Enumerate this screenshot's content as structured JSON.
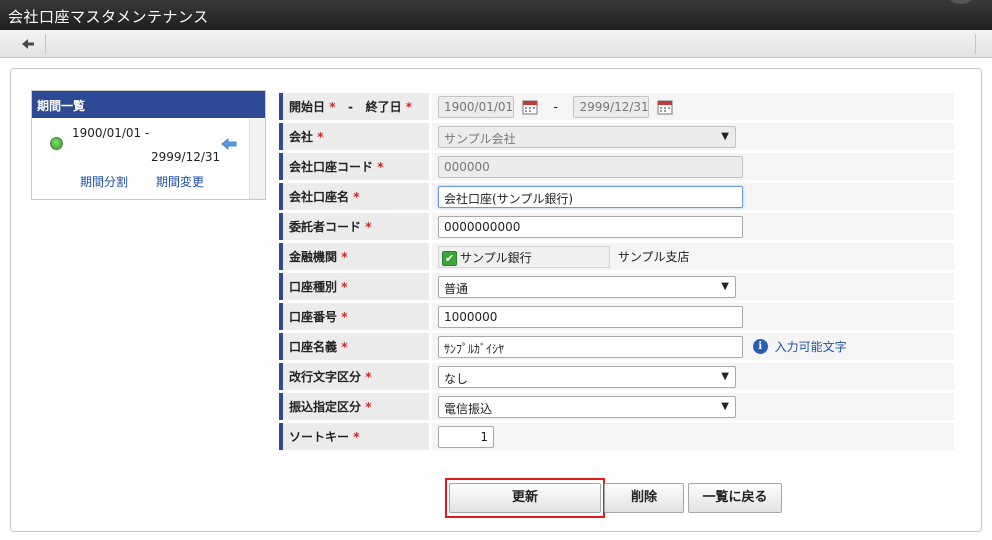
{
  "window": {
    "title": "会社口座マスタメンテナンス"
  },
  "toolbar": {
    "back_icon": "back-arrow-icon"
  },
  "period_list": {
    "header": "期間一覧",
    "items": [
      {
        "start": "1900/01/01  -",
        "end": "2999/12/31"
      }
    ],
    "split_link": "期間分割",
    "change_link": "期間変更"
  },
  "form": {
    "period": {
      "start_label": "開始日",
      "sep": "-",
      "end_label": "終了日",
      "start_value": "1900/01/01",
      "end_value": "2999/12/31",
      "range_sep": "-"
    },
    "company": {
      "label": "会社",
      "value": "サンプル会社"
    },
    "account_code": {
      "label": "会社口座コード",
      "value": "000000"
    },
    "account_name": {
      "label": "会社口座名",
      "value": "会社口座(サンプル銀行)"
    },
    "consignor_code": {
      "label": "委託者コード",
      "value": "0000000000"
    },
    "bank": {
      "label": "金融機関",
      "bank_name": "サンプル銀行",
      "branch_name": "サンプル支店"
    },
    "account_type": {
      "label": "口座種別",
      "value": "普通"
    },
    "account_number": {
      "label": "口座番号",
      "value": "1000000"
    },
    "account_holder": {
      "label": "口座名義",
      "value": "ｻﾝﾌﾟﾙｶﾞｲｼﾔ",
      "help_link": "入力可能文字"
    },
    "line_break": {
      "label": "改行文字区分",
      "value": "なし"
    },
    "transfer_type": {
      "label": "振込指定区分",
      "value": "電信振込"
    },
    "sort_key": {
      "label": "ソートキー",
      "value": "1"
    },
    "required_mark": "*"
  },
  "buttons": {
    "update": "更新",
    "delete": "削除",
    "back_to_list": "一覧に戻る"
  },
  "colors": {
    "header_blue": "#2e4a94",
    "highlight_red": "#e01b1b",
    "required_red": "#dd2222"
  }
}
